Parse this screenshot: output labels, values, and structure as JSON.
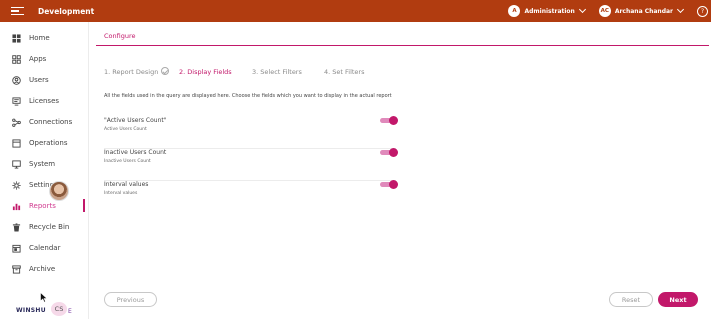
{
  "header": {
    "app_title": "Development",
    "role_avatar": "A",
    "role_label": "Administration",
    "user_avatar": "AC",
    "user_name": "Archana Chandar",
    "help_glyph": "?",
    "colors": {
      "bar": "#b13c10"
    }
  },
  "sidebar": {
    "items": [
      {
        "label": "Home",
        "icon": "home-grid-icon"
      },
      {
        "label": "Apps",
        "icon": "apps-grid-icon"
      },
      {
        "label": "Users",
        "icon": "users-icon"
      },
      {
        "label": "Licenses",
        "icon": "license-icon"
      },
      {
        "label": "Connections",
        "icon": "connections-icon"
      },
      {
        "label": "Operations",
        "icon": "operations-icon"
      },
      {
        "label": "System",
        "icon": "system-monitor-icon"
      },
      {
        "label": "Settings",
        "icon": "gear-icon"
      },
      {
        "label": "Reports",
        "icon": "bar-chart-icon",
        "active": true
      },
      {
        "label": "Recycle Bin",
        "icon": "trash-icon"
      },
      {
        "label": "Calendar",
        "icon": "calendar-icon"
      },
      {
        "label": "Archive",
        "icon": "archive-icon"
      }
    ],
    "bottom_logo_text": "WINSHU",
    "bottom_badge": "CS",
    "bottom_extra": "E"
  },
  "main": {
    "tab_label": "Configure",
    "steps": [
      {
        "label": "1. Report Design",
        "completed": true
      },
      {
        "label": "2. Display Fields",
        "current": true
      },
      {
        "label": "3. Select Filters"
      },
      {
        "label": "4. Set Filters"
      }
    ],
    "intro_text": "All the fields used in the query are displayed here. Choose the fields which you want to display in the actual report",
    "fields": [
      {
        "title": "\"Active Users Count\"",
        "subtitle": "Active Users Count",
        "enabled": true
      },
      {
        "title": "Inactive Users Count",
        "subtitle": "Inactive Users Count",
        "enabled": true
      },
      {
        "title": "Interval values",
        "subtitle": "Interval values",
        "enabled": true
      }
    ],
    "buttons": {
      "previous": "Previous",
      "reset": "Reset",
      "next": "Next"
    },
    "accent_color": "#c2186a"
  }
}
